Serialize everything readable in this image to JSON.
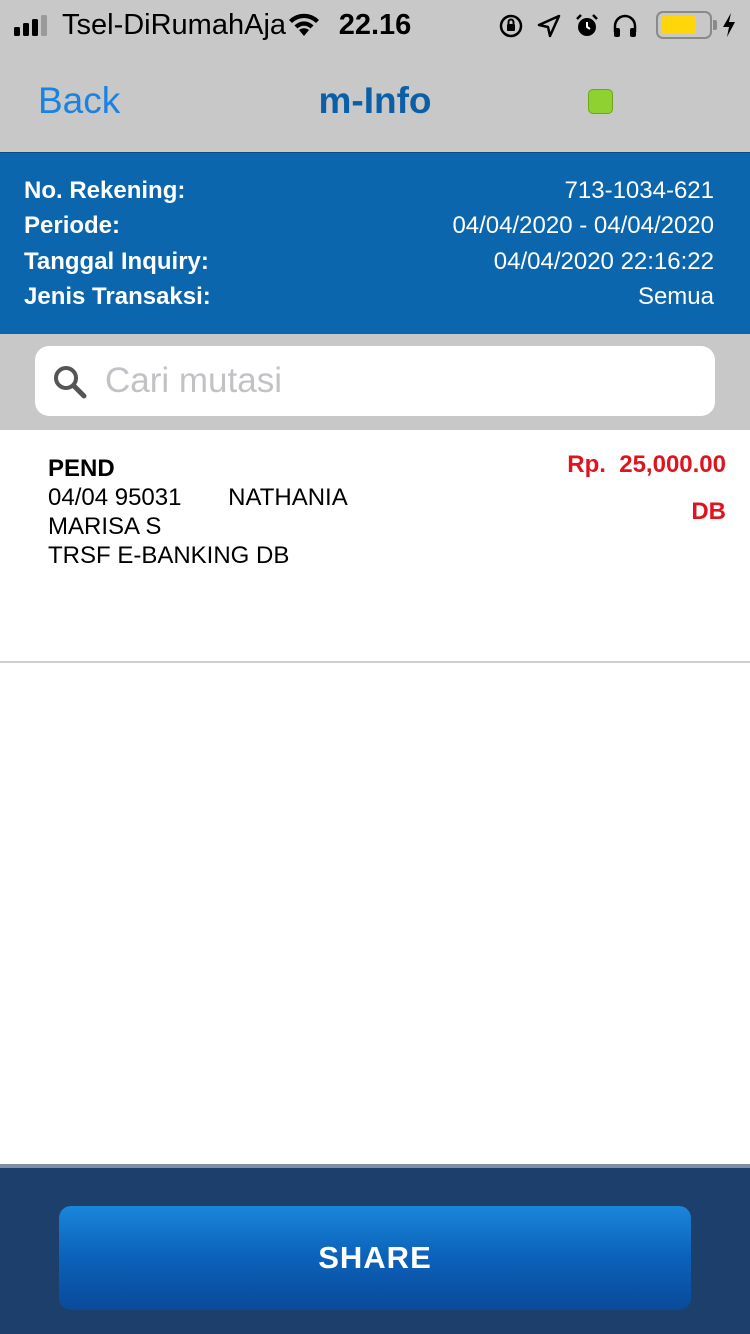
{
  "status_bar": {
    "carrier": "Tsel-DiRumahAja",
    "time": "22.16",
    "battery_level": 0.72,
    "battery_color": "#ffd60a"
  },
  "navbar": {
    "back_label": "Back",
    "title": "m-Info",
    "indicator_color": "#8fd130"
  },
  "account_info": {
    "rows": [
      {
        "label": "No. Rekening:",
        "value": "713-1034-621"
      },
      {
        "label": "Periode:",
        "value": "04/04/2020 - 04/04/2020"
      },
      {
        "label": "Tanggal Inquiry:",
        "value": "04/04/2020 22:16:22"
      },
      {
        "label": "Jenis Transaksi:",
        "value": "Semua"
      }
    ]
  },
  "search": {
    "placeholder": "Cari mutasi",
    "value": ""
  },
  "transactions": [
    {
      "type": "PEND",
      "line1": "04/04 95031       NATHANIA",
      "line2": "MARISA S",
      "line3": "TRSF E-BANKING DB",
      "amount": "Rp.  25,000.00",
      "dbcr": "DB"
    }
  ],
  "footer": {
    "share_label": "SHARE"
  },
  "colors": {
    "header_blue": "#0b66ad",
    "title_blue": "#0b5fa6",
    "link_blue": "#1a82e2",
    "amount_red": "#e0141e",
    "footer_navy": "#1d3f6b"
  }
}
